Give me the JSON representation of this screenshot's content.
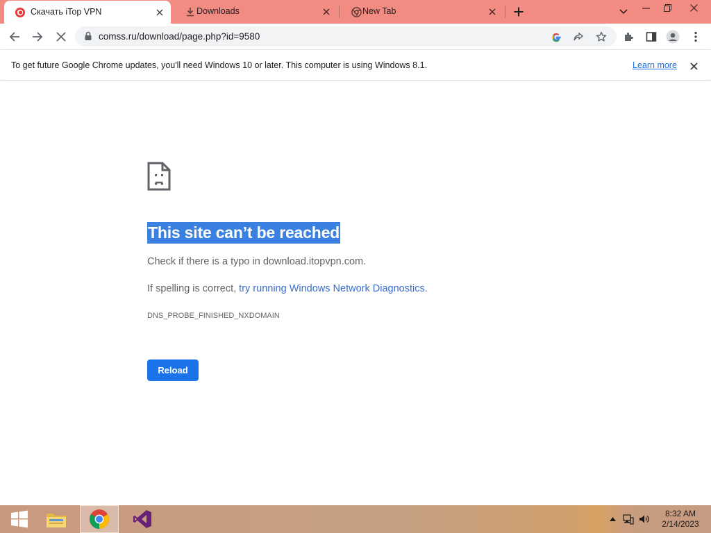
{
  "tabs": [
    {
      "title": "Скачать iTop VPN",
      "favicon": "itop-favicon",
      "active": true
    },
    {
      "title": "Downloads",
      "favicon": "download-icon",
      "active": false
    },
    {
      "title": "New Tab",
      "favicon": "chrome-icon",
      "active": false
    }
  ],
  "toolbar": {
    "url": "comss.ru/download/page.php?id=9580"
  },
  "infobar": {
    "message": "To get future Google Chrome updates, you'll need Windows 10 or later. This computer is using Windows 8.1.",
    "link": "Learn more"
  },
  "error_page": {
    "title": "This site can’t be reached",
    "line1": "Check if there is a typo in download.itopvpn.com.",
    "line2_prefix": "If spelling is correct, ",
    "line2_link": "try running Windows Network Diagnostics",
    "line2_suffix": ".",
    "code": "DNS_PROBE_FINISHED_NXDOMAIN",
    "reload_label": "Reload"
  },
  "taskbar": {
    "items": [
      "start-icon",
      "file-explorer-icon",
      "chrome-icon",
      "visual-studio-icon"
    ],
    "time": "8:32 AM",
    "date": "2/14/2023"
  },
  "colors": {
    "tabstrip": "#f28b82",
    "accent": "#1a73e8",
    "selection": "#3a80e0",
    "link": "#3a6ec9"
  }
}
